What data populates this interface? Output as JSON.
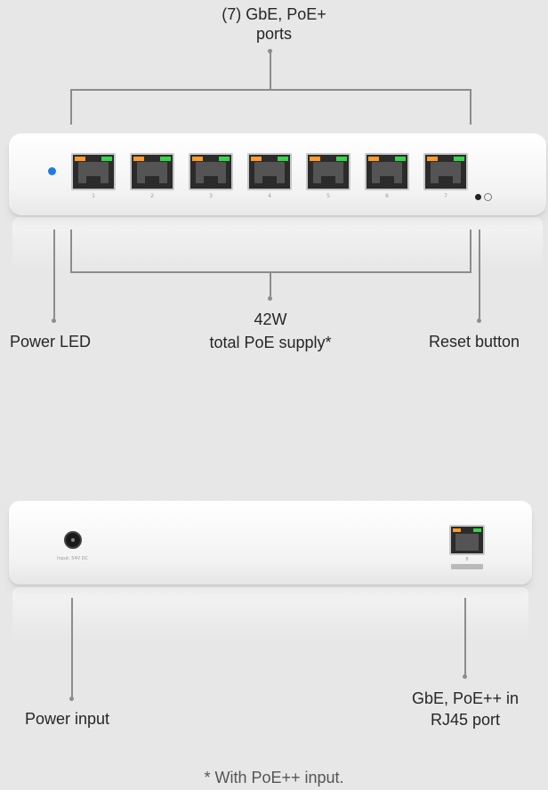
{
  "front": {
    "ports_label_line1": "(7) GbE, PoE+",
    "ports_label_line2": "ports",
    "power_led_label": "Power LED",
    "poe_label_line1": "42W",
    "poe_label_line2": "total PoE supply*",
    "reset_label": "Reset button",
    "port_numbers": [
      "1",
      "2",
      "3",
      "4",
      "5",
      "6",
      "7"
    ],
    "power_led_color": "#1f7ae8"
  },
  "rear": {
    "power_input_label": "Power input",
    "uplink_label_line1": "GbE, PoE++ in",
    "uplink_label_line2": "RJ45 port",
    "dc_text": "Input: 54V DC",
    "port_number": "8"
  },
  "footnote": "* With PoE++ input.",
  "colors": {
    "background": "#e7e7e7",
    "port_led_orange": "#ff9a2c",
    "port_led_green": "#37d34a"
  }
}
